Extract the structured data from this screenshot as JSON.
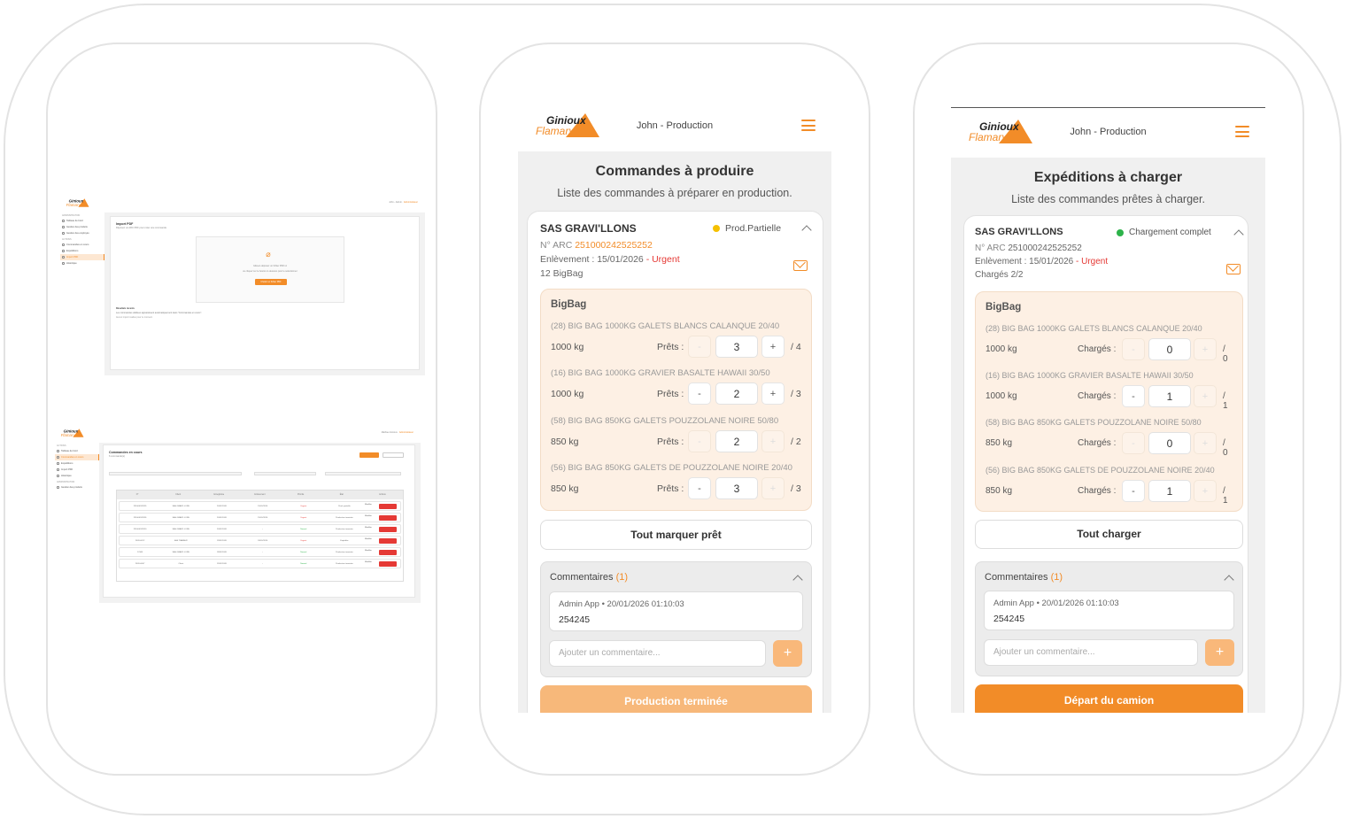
{
  "brand": {
    "name_top": "Ginioux",
    "name_bottom": "Flamary",
    "accent": "#f28c28",
    "urgent": "#e53935"
  },
  "desktop_import": {
    "user": "John - Admin",
    "user_role": "Administrateur",
    "sidebar_sections": [
      {
        "title": "ADMINISTRATION",
        "items": [
          "Tableau de bord",
          "Gestion des produits",
          "Gestion des employés"
        ]
      },
      {
        "title": "ACTIONS",
        "items": [
          "Commandes en cours",
          "Expéditions",
          "Import PDF",
          "Historique"
        ]
      }
    ],
    "page_title": "Import PDF",
    "page_subtitle": "Déposez un ARC PDF pour créer une commande.",
    "drop_text": "Glissez-déposez un fichier PDF ici",
    "drop_text2": "ou cliquez sur le bouton ci-dessous pour le sélectionner",
    "drop_button": "Choisir un fichier PDF",
    "footer_title": "Résultats récents",
    "footer_line1": "Les commandes validées apparaissent automatiquement dans \"Commandes en cours\".",
    "footer_line2": "Aucun import réalisé pour le moment."
  },
  "desktop_orders": {
    "user": "Mathieu Ginioux",
    "user_role": "Administrateur",
    "sidebar_sections": [
      {
        "title": "ACTIONS",
        "items": [
          "Tableau de bord",
          "Commandes en cours",
          "Expéditions",
          "Import PDF",
          "Historique"
        ]
      },
      {
        "title": "ADMINISTRATION",
        "items": [
          "Gestion des produits"
        ]
      }
    ],
    "page_title": "Commandes en cours",
    "page_subtitle": "6 commande(s)",
    "columns": [
      "N°",
      "Client",
      "Enregistrée",
      "Enlèvement",
      "Priorité",
      "État",
      "Actions"
    ],
    "rows": [
      {
        "id": "251000242525",
        "client": "SAS GRAVI'LLONS",
        "date": "20/01/2026",
        "pickup": "15/01/2026",
        "priority": "Urgent",
        "state": "Prod. partielle"
      },
      {
        "id": "251000242526",
        "client": "SAS GRAVI'LLONS",
        "date": "20/01/2026",
        "pickup": "15/01/2026",
        "priority": "Urgent",
        "state": "Production terminée"
      },
      {
        "id": "251000242520",
        "client": "SAS GRAVI'LLONS",
        "date": "20/01/2026",
        "pickup": "-",
        "priority": "Normal",
        "state": "Production terminée"
      },
      {
        "id": "2026-0012",
        "client": "SAS TRAVAUX",
        "date": "19/01/2026",
        "pickup": "18/01/2026",
        "priority": "Urgent",
        "state": "Expédiée"
      },
      {
        "id": "12345",
        "client": "SAS GRAVI'LLONS",
        "date": "18/01/2026",
        "pickup": "-",
        "priority": "Normal",
        "state": "Production terminée"
      },
      {
        "id": "2026-0007",
        "client": "Client",
        "date": "15/01/2026",
        "pickup": "-",
        "priority": "Normal",
        "state": "Production terminée"
      }
    ],
    "modify_label": "Modifier",
    "delete_label": "Supprimer"
  },
  "production": {
    "user": "John - Production",
    "title": "Commandes à produire",
    "subtitle": "Liste des commandes à préparer en production.",
    "client": "SAS GRAVI'LLONS",
    "status": "Prod.Partielle",
    "status_color": "#f5c000",
    "arc_label": "N° ARC",
    "arc": "251000242525252",
    "pickup": "Enlèvement : 15/01/2026",
    "urgent": "- Urgent",
    "count": "12 BigBag",
    "group": "BigBag",
    "qty_label": "Prêts :",
    "items": [
      {
        "name": "(28) BIG BAG 1000KG GALETS BLANCS CALANQUE 20/40",
        "weight": "1000 kg",
        "qty": "3",
        "total": "/ 4"
      },
      {
        "name": "(16) BIG BAG 1000KG GRAVIER BASALTE HAWAII 30/50",
        "weight": "1000 kg",
        "qty": "2",
        "total": "/ 3"
      },
      {
        "name": "(58) BIG BAG 850KG GALETS POUZZOLANE NOIRE 50/80",
        "weight": "850 kg",
        "qty": "2",
        "total": "/ 2"
      },
      {
        "name": "(56) BIG BAG 850KG GALETS DE POUZZOLANE NOIRE 20/40",
        "weight": "850 kg",
        "qty": "3",
        "total": "/ 3"
      }
    ],
    "mark_all": "Tout marquer prêt",
    "comments_label": "Commentaires",
    "comments_count": "(1)",
    "comment_meta": "Admin App • 20/01/2026 01:10:03",
    "comment_text": "254245",
    "comment_placeholder": "Ajouter un commentaire...",
    "finish": "Production terminée"
  },
  "shipping": {
    "user": "John - Production",
    "title": "Expéditions à charger",
    "subtitle": "Liste des commandes prêtes à charger.",
    "client": "SAS GRAVI'LLONS",
    "status": "Chargement complet",
    "status_color": "#2db34a",
    "arc_label": "N° ARC",
    "arc": "251000242525252",
    "pickup": "Enlèvement : 15/01/2026",
    "urgent": "- Urgent",
    "count": "Chargés 2/2",
    "group": "BigBag",
    "qty_label": "Chargés :",
    "items": [
      {
        "name": "(28) BIG BAG 1000KG GALETS BLANCS CALANQUE 20/40",
        "weight": "1000 kg",
        "qty": "0",
        "total": "/ 0"
      },
      {
        "name": "(16) BIG BAG 1000KG GRAVIER BASALTE HAWAII 30/50",
        "weight": "1000 kg",
        "qty": "1",
        "total": "/ 1"
      },
      {
        "name": "(58) BIG BAG 850KG GALETS POUZZOLANE NOIRE 50/80",
        "weight": "850 kg",
        "qty": "0",
        "total": "/ 0"
      },
      {
        "name": "(56) BIG BAG 850KG GALETS DE POUZZOLANE NOIRE 20/40",
        "weight": "850 kg",
        "qty": "1",
        "total": "/ 1"
      }
    ],
    "load_all": "Tout charger",
    "comments_label": "Commentaires",
    "comments_count": "(1)",
    "comment_meta": "Admin App • 20/01/2026 01:10:03",
    "comment_text": "254245",
    "comment_placeholder": "Ajouter un commentaire...",
    "depart": "Départ du camion"
  }
}
